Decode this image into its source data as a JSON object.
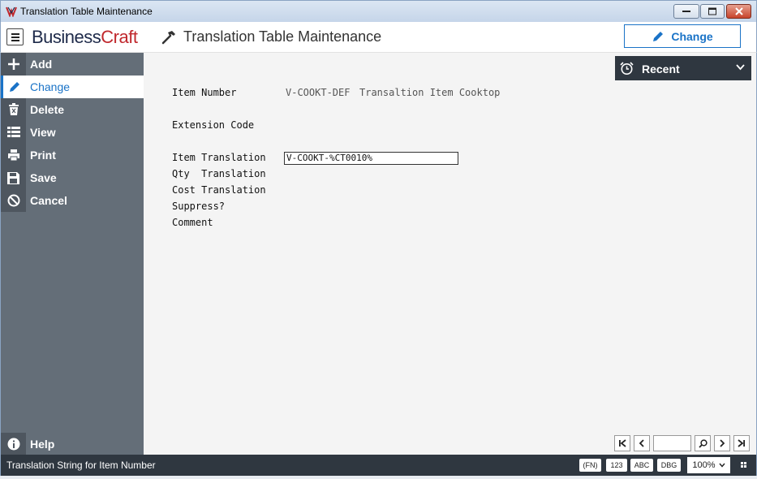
{
  "window": {
    "title": "Translation Table Maintenance"
  },
  "header": {
    "logo_part1": "Business",
    "logo_part2": "Craft",
    "page_title": "Translation Table Maintenance",
    "mode_label": "Change"
  },
  "sidebar": {
    "items": [
      {
        "label": "Add",
        "icon": "plus-icon"
      },
      {
        "label": "Change",
        "icon": "pencil-icon",
        "active": true
      },
      {
        "label": "Delete",
        "icon": "trash-icon"
      },
      {
        "label": "View",
        "icon": "list-icon"
      },
      {
        "label": "Print",
        "icon": "printer-icon"
      },
      {
        "label": "Save",
        "icon": "floppy-icon"
      },
      {
        "label": "Cancel",
        "icon": "cancel-icon"
      }
    ],
    "help_label": "Help"
  },
  "recent": {
    "label": "Recent"
  },
  "form": {
    "item_number_label": "Item Number",
    "item_number_value": "V-COOKT-DEF",
    "item_number_desc": "Transaltion Item Cooktop",
    "extension_code_label": "Extension Code",
    "item_translation_label": "Item Translation",
    "item_translation_value": "V-COOKT-%CT0010%",
    "qty_translation_label": "Qty  Translation",
    "cost_translation_label": "Cost Translation",
    "suppress_label": "Suppress?",
    "comment_label": "Comment"
  },
  "pager": {
    "page_value": ""
  },
  "statusbar": {
    "message": "Translation String for Item Number",
    "fn_label": "(FN)",
    "num_label": "123",
    "abc_label": "ABC",
    "dbg_label": "DBG",
    "zoom_label": "100%"
  },
  "colors": {
    "accent": "#1a73c7",
    "sidebar": "#646e78",
    "dark": "#2f3740",
    "brand_red": "#c0282d"
  }
}
